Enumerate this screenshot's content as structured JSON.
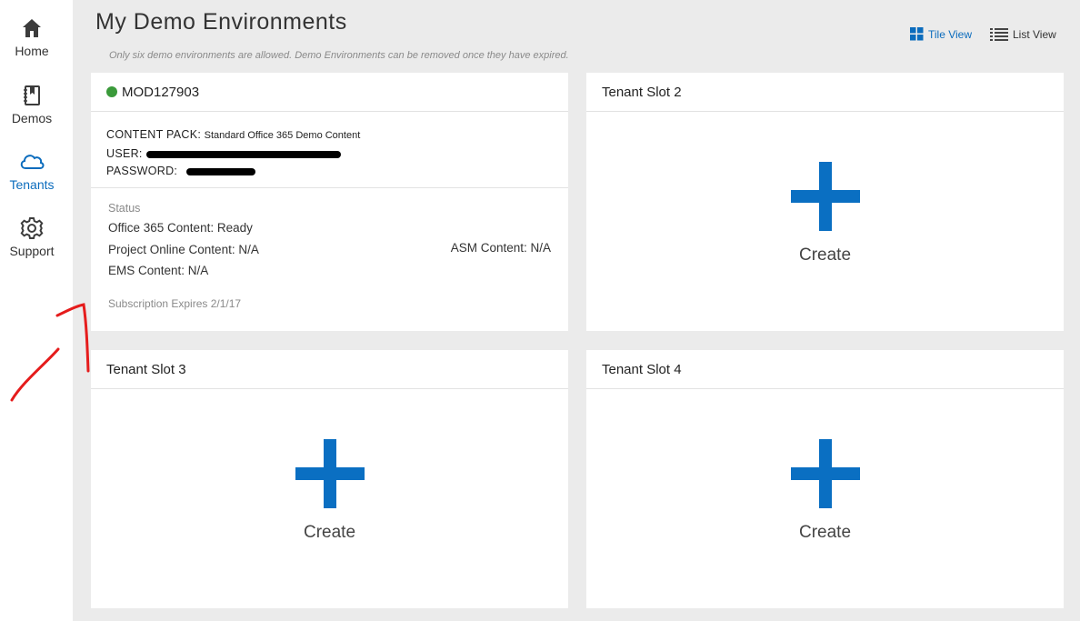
{
  "sidebar": {
    "items": [
      {
        "label": "Home",
        "icon": "home-icon"
      },
      {
        "label": "Demos",
        "icon": "book-icon"
      },
      {
        "label": "Tenants",
        "icon": "cloud-icon",
        "active": true
      },
      {
        "label": "Support",
        "icon": "gear-icon"
      }
    ]
  },
  "header": {
    "title": "My Demo Environments",
    "notice": "Only six demo environments are allowed. Demo Environments can be removed once they have expired.",
    "tile_view": "Tile View",
    "list_view": "List View"
  },
  "tenant": {
    "name": "MOD127903",
    "status_color": "#3a9a3a",
    "content_pack_key": "CONTENT PACK:",
    "content_pack_value": "Standard Office 365 Demo Content",
    "user_key": "USER:",
    "password_key": "PASSWORD:",
    "status_heading": "Status",
    "office_content": "Office 365 Content: Ready",
    "project_content": "Project Online Content: N/A",
    "asm_content": "ASM Content: N/A",
    "ems_content": "EMS Content: N/A",
    "expires": "Subscription Expires 2/1/17"
  },
  "slots": [
    {
      "title": "Tenant Slot 2",
      "action": "Create"
    },
    {
      "title": "Tenant Slot 3",
      "action": "Create"
    },
    {
      "title": "Tenant Slot 4",
      "action": "Create"
    }
  ],
  "colors": {
    "accent": "#0b6cbd",
    "plus": "#0a6fc2",
    "annotation": "#e51c1c",
    "background": "#ebebeb"
  }
}
